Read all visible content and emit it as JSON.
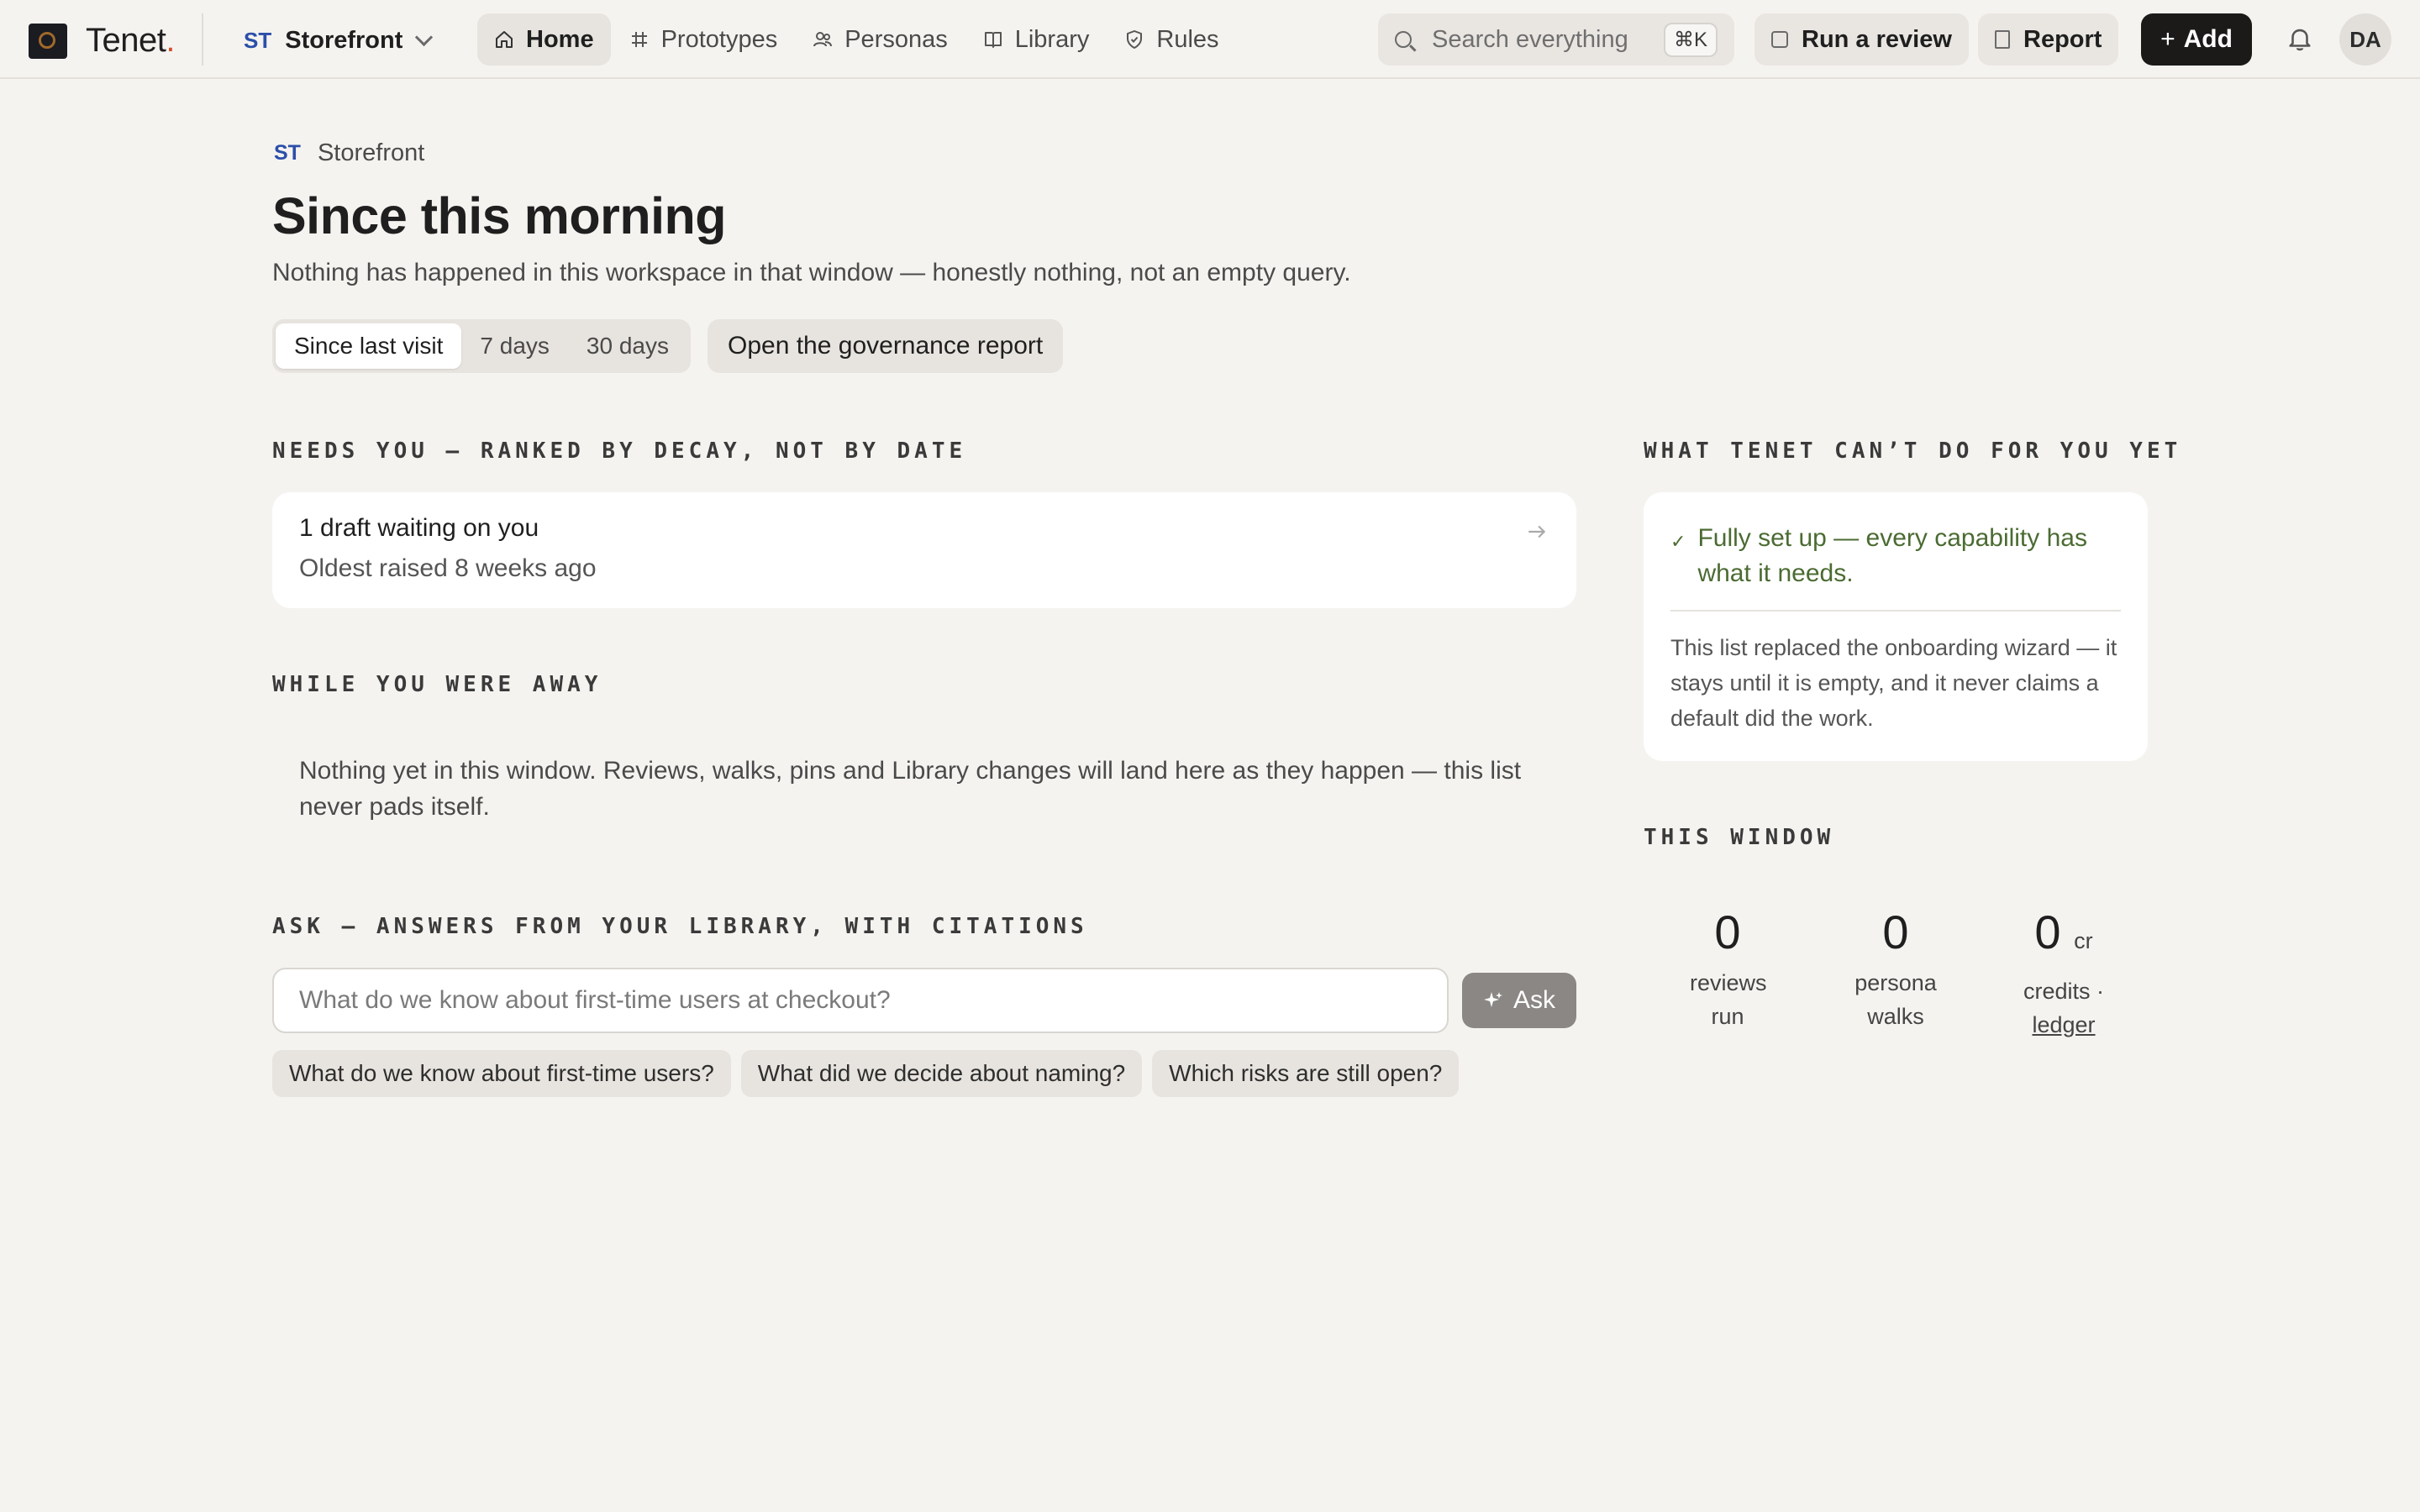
{
  "app": {
    "name": "Tenet",
    "name_dot": ".",
    "workspace_code": "ST",
    "workspace_name": "Storefront"
  },
  "nav": [
    {
      "label": "Home",
      "icon": "home-icon",
      "active": true
    },
    {
      "label": "Prototypes",
      "icon": "hash-frame-icon"
    },
    {
      "label": "Personas",
      "icon": "people-icon"
    },
    {
      "label": "Library",
      "icon": "book-icon"
    },
    {
      "label": "Rules",
      "icon": "shield-icon"
    }
  ],
  "search": {
    "placeholder": "Search everything",
    "shortcut": "⌘K"
  },
  "actions": {
    "run_review": "Run a review",
    "report": "Report",
    "add": "Add",
    "add_icon": "+"
  },
  "user": {
    "initials": "DA"
  },
  "header": {
    "crumb_code": "ST",
    "crumb_name": "Storefront",
    "title": "Since this morning",
    "subtitle": "Nothing has happened in this workspace in that window — honestly nothing, not an empty query."
  },
  "range": {
    "options": [
      "Since last visit",
      "7 days",
      "30 days"
    ],
    "selected": "Since last visit"
  },
  "governance_button": "Open the governance report",
  "needs": {
    "label": "Needs you — ranked by decay, not by date",
    "item_title": "1 draft waiting on you",
    "item_sub": "Oldest raised 8 weeks ago"
  },
  "away": {
    "label": "While you were away",
    "text": "Nothing yet in this window. Reviews, walks, pins and Library changes will land here as they happen — this list never pads itself."
  },
  "ask": {
    "label": "Ask — answers from your library, with citations",
    "placeholder": "What do we know about first-time users at checkout?",
    "button": "Ask",
    "suggestions": [
      "What do we know about first-time users?",
      "What did we decide about naming?",
      "Which risks are still open?"
    ]
  },
  "cant": {
    "label": "What Tenet can’t do for you yet",
    "status": "Fully set up — every capability has what it needs.",
    "note": "This list replaced the onboarding wizard — it stays until it is empty, and it never claims a default did the work."
  },
  "window": {
    "label": "This window",
    "stats": [
      {
        "value": "0",
        "label": "reviews run"
      },
      {
        "value": "0",
        "label": "persona walks"
      },
      {
        "value": "0",
        "unit": "cr",
        "label": "credits ·",
        "link": "ledger"
      }
    ]
  }
}
